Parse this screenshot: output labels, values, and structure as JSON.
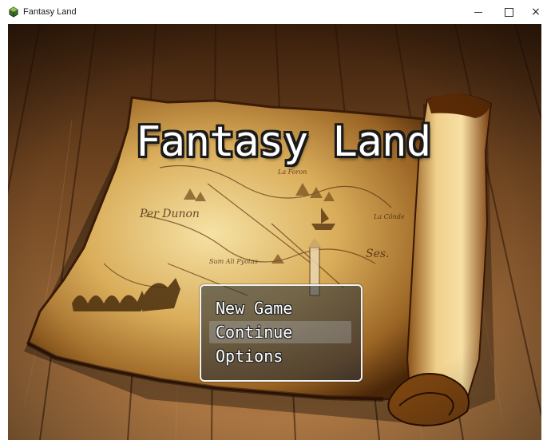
{
  "window": {
    "title": "Fantasy Land",
    "icon": "game-app-icon",
    "controls": [
      "minimize",
      "maximize",
      "close"
    ],
    "close_glyph": "×"
  },
  "game": {
    "title": "Fantasy Land",
    "menu": {
      "items": [
        "New Game",
        "Continue",
        "Options"
      ],
      "selected_index": 1
    }
  },
  "colors": {
    "title_text": "#ffffff",
    "title_outline": "#1a1a1a",
    "menu_border": "#f2f2f2",
    "wood_floor": "#6b3f1c",
    "parchment": "#d9a84a"
  }
}
